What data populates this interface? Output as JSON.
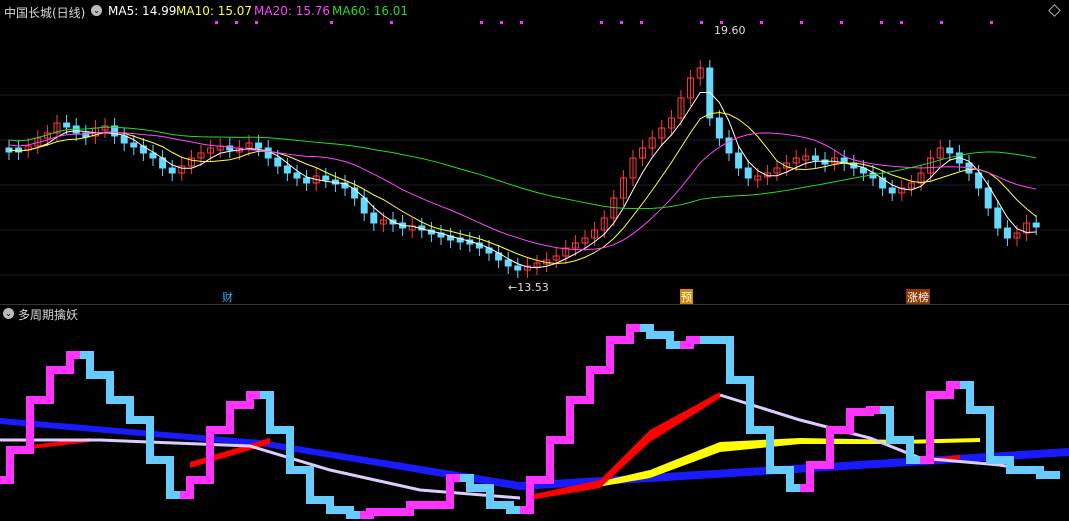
{
  "header": {
    "title": "中国长城(日线)",
    "ma5": "MA5: 14.99",
    "ma10": "MA10: 15.07",
    "ma20": "MA20: 15.76",
    "ma60": "MA60: 16.01"
  },
  "price_chart": {
    "high_label": "19.60",
    "low_label": "←13.53",
    "events": {
      "cai": "财",
      "yu": "预",
      "zhangting": "涨榜"
    },
    "colors": {
      "up": "#ff3b3b",
      "down": "#66d9ff",
      "ma5": "#ffffff",
      "ma10": "#ffff33",
      "ma20": "#ff44ff",
      "ma60": "#22dd22"
    }
  },
  "indicator": {
    "title": "多周期擒妖",
    "colors": {
      "magenta": "#ff33ff",
      "skyblue": "#66ccff",
      "blue": "#1a1aff",
      "red": "#ff0000",
      "yellow": "#ffff00",
      "lavender": "#ddccff"
    }
  }
}
